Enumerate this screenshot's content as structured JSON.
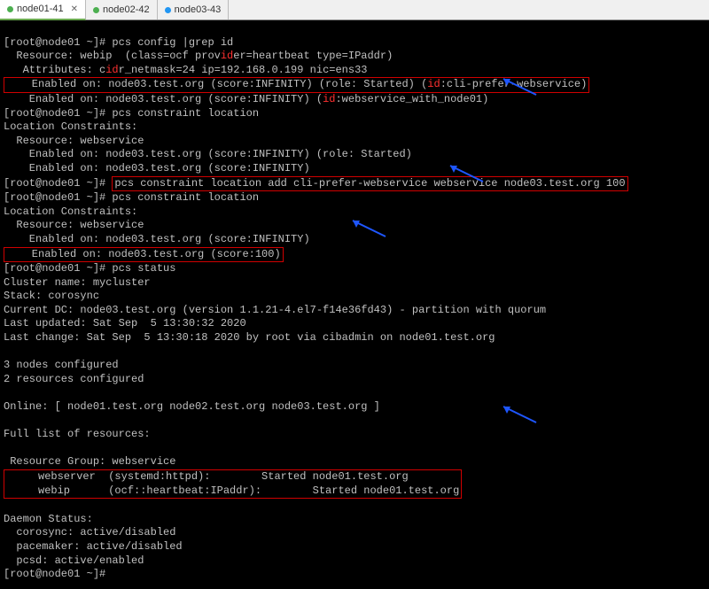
{
  "tabs": [
    {
      "label": "node01-41",
      "active": true,
      "status": "active"
    },
    {
      "label": "node02-42",
      "active": false,
      "status": "active"
    },
    {
      "label": "node03-43",
      "active": false,
      "status": "idle"
    }
  ],
  "prompt": "[root@node01 ~]#",
  "cmd1": "pcs config |grep id",
  "l1": "  Resource: webip  (class=ocf prov",
  "l1_hl": "id",
  "l1b": "er=heartbeat type=IPaddr)",
  "l2": "   Attributes: c",
  "l2_hl": "id",
  "l2b": "r_netmask=24 ip=192.168.0.199 nic=ens33",
  "l3": "    Enabled on: node03.test.org (score:INFINITY) (role: Started) (",
  "l3_hl": "id",
  "l3b": ":cli-prefer-webservice)",
  "l4": "    Enabled on: node03.test.org (score:INFINITY) (",
  "l4_hl": "id",
  "l4b": ":webservice_with_node01)",
  "cmd2": "pcs constraint location",
  "l5": "Location Constraints:",
  "l6": "  Resource: webservice",
  "l7": "    Enabled on: node03.test.org (score:INFINITY) (role: Started)",
  "l8": "    Enabled on: node03.test.org (score:INFINITY)",
  "cmd3": "pcs constraint location add cli-prefer-webservice webservice node03.test.org 100",
  "cmd4": "pcs constraint location",
  "l9": "Location Constraints:",
  "l10": "  Resource: webservice",
  "l11": "    Enabled on: node03.test.org (score:INFINITY)",
  "l12": "    Enabled on: node03.test.org (score:100)",
  "cmd5": "pcs status",
  "l13": "Cluster name: mycluster",
  "l14": "Stack: corosync",
  "l15": "Current DC: node03.test.org (version 1.1.21-4.el7-f14e36fd43) - partition with quorum",
  "l16": "Last updated: Sat Sep  5 13:30:32 2020",
  "l17": "Last change: Sat Sep  5 13:30:18 2020 by root via cibadmin on node01.test.org",
  "l18": "3 nodes configured",
  "l19": "2 resources configured",
  "l20": "Online: [ node01.test.org node02.test.org node03.test.org ]",
  "l21": "Full list of resources:",
  "l22": " Resource Group: webservice",
  "l23": "     webserver  (systemd:httpd):        Started node01.test.org",
  "l24": "     webip      (ocf::heartbeat:IPaddr):        Started node01.test.org",
  "l25": "Daemon Status:",
  "l26": "  corosync: active/disabled",
  "l27": "  pacemaker: active/disabled",
  "l28": "  pcsd: active/enabled"
}
